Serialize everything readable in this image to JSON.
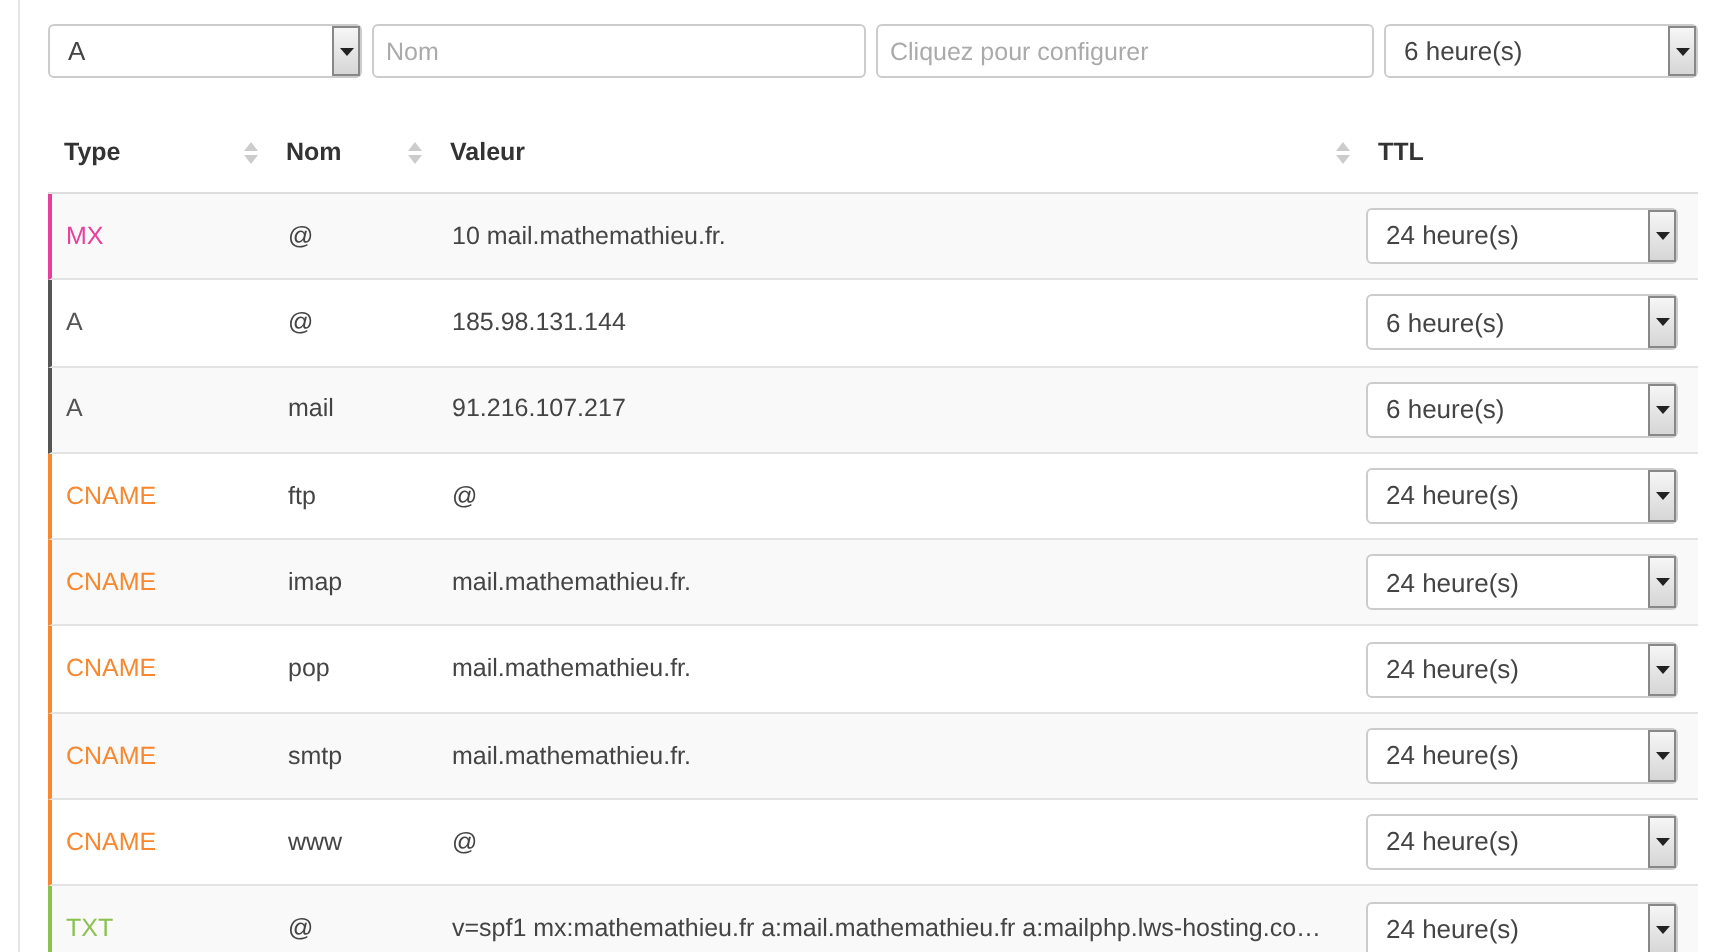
{
  "filters": {
    "type": "A",
    "name": {
      "placeholder": "Nom"
    },
    "value": {
      "placeholder": "Cliquez pour configurer"
    },
    "ttl": "6 heure(s)"
  },
  "table": {
    "columns": [
      "Type",
      "Nom",
      "Valeur",
      "TTL"
    ],
    "rows": [
      {
        "type": "MX",
        "color": "#e83e9c",
        "name": "@",
        "value": "10 mail.mathemathieu.fr.",
        "ttl": "24 heure(s)"
      },
      {
        "type": "A",
        "color": "#555555",
        "name": "@",
        "value": "185.98.131.144",
        "ttl": "6 heure(s)"
      },
      {
        "type": "A",
        "color": "#555555",
        "name": "mail",
        "value": "91.216.107.217",
        "ttl": "6 heure(s)"
      },
      {
        "type": "CNAME",
        "color": "#f7882f",
        "name": "ftp",
        "value": "@",
        "ttl": "24 heure(s)"
      },
      {
        "type": "CNAME",
        "color": "#f7882f",
        "name": "imap",
        "value": "mail.mathemathieu.fr.",
        "ttl": "24 heure(s)"
      },
      {
        "type": "CNAME",
        "color": "#f7882f",
        "name": "pop",
        "value": "mail.mathemathieu.fr.",
        "ttl": "24 heure(s)"
      },
      {
        "type": "CNAME",
        "color": "#f7882f",
        "name": "smtp",
        "value": "mail.mathemathieu.fr.",
        "ttl": "24 heure(s)"
      },
      {
        "type": "CNAME",
        "color": "#f7882f",
        "name": "www",
        "value": "@",
        "ttl": "24 heure(s)"
      },
      {
        "type": "TXT",
        "color": "#8cc152",
        "name": "@",
        "value": "v=spf1 mx:mathemathieu.fr a:mail.mathemathieu.fr a:mailphp.lws-hosting.co…",
        "ttl": "24 heure(s)"
      }
    ]
  }
}
